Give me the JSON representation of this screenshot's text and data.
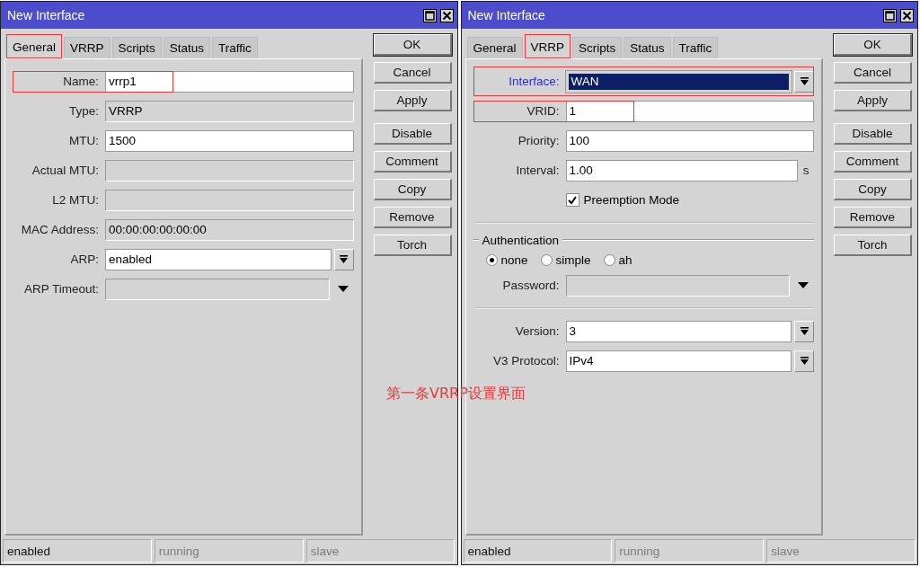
{
  "windows": [
    {
      "title": "New Interface",
      "tabs": [
        {
          "label": "General",
          "selected": true,
          "highlighted": true
        },
        {
          "label": "VRRP",
          "selected": false,
          "highlighted": false
        },
        {
          "label": "Scripts",
          "selected": false,
          "highlighted": false
        },
        {
          "label": "Status",
          "selected": false,
          "highlighted": false
        },
        {
          "label": "Traffic",
          "selected": false,
          "highlighted": false
        }
      ],
      "fields": [
        {
          "kind": "text",
          "label": "Name:",
          "value": "vrrp1",
          "highlighted": true
        },
        {
          "kind": "readonly",
          "label": "Type:",
          "value": "VRRP"
        },
        {
          "kind": "text",
          "label": "MTU:",
          "value": "1500"
        },
        {
          "kind": "readonly",
          "label": "Actual MTU:"
        },
        {
          "kind": "readonly",
          "label": "L2 MTU:"
        },
        {
          "kind": "readonly",
          "label": "MAC Address:",
          "value": "00:00:00:00:00:00"
        },
        {
          "kind": "dropdown",
          "label": "ARP:",
          "value": "enabled"
        },
        {
          "kind": "dropdown-disabled",
          "label": "ARP Timeout:"
        }
      ],
      "button_groups": [
        [
          {
            "label": "OK",
            "default": true
          },
          {
            "label": "Cancel",
            "default": false
          },
          {
            "label": "Apply",
            "default": false
          }
        ],
        [
          {
            "label": "Disable",
            "default": false
          },
          {
            "label": "Comment",
            "default": false
          },
          {
            "label": "Copy",
            "default": false
          },
          {
            "label": "Remove",
            "default": false
          },
          {
            "label": "Torch",
            "default": false
          }
        ]
      ],
      "status_bar": [
        {
          "text": "enabled",
          "disabled": false
        },
        {
          "text": "running",
          "disabled": true
        },
        {
          "text": "slave",
          "disabled": true
        }
      ]
    },
    {
      "title": "New Interface",
      "tabs": [
        {
          "label": "General",
          "selected": false,
          "highlighted": false
        },
        {
          "label": "VRRP",
          "selected": true,
          "highlighted": true
        },
        {
          "label": "Scripts",
          "selected": false,
          "highlighted": false
        },
        {
          "label": "Status",
          "selected": false,
          "highlighted": false
        },
        {
          "label": "Traffic",
          "selected": false,
          "highlighted": false
        }
      ],
      "fields": [
        {
          "kind": "dropdown",
          "label": "Interface:",
          "value": "WAN",
          "focused": true,
          "highlighted": true
        },
        {
          "kind": "text",
          "label": "VRID:",
          "value": "1",
          "highlighted": true
        },
        {
          "kind": "text",
          "label": "Priority:",
          "value": "100"
        },
        {
          "kind": "text",
          "label": "Interval:",
          "value": "1.00",
          "unit": "s"
        },
        {
          "kind": "checkbox",
          "label": "Preemption Mode",
          "checked": true
        },
        {
          "kind": "separator"
        },
        {
          "kind": "section",
          "label": "Authentication"
        },
        {
          "kind": "radio",
          "options": [
            {
              "label": "none",
              "selected": true
            },
            {
              "label": "simple",
              "selected": false
            },
            {
              "label": "ah",
              "selected": false
            }
          ]
        },
        {
          "kind": "dropdown-disabled",
          "label": "Password:"
        },
        {
          "kind": "separator"
        },
        {
          "kind": "dropdown",
          "label": "Version:",
          "value": "3"
        },
        {
          "kind": "dropdown",
          "label": "V3 Protocol:",
          "value": "IPv4"
        }
      ],
      "button_groups": [
        [
          {
            "label": "OK",
            "default": true
          },
          {
            "label": "Cancel",
            "default": false
          },
          {
            "label": "Apply",
            "default": false
          }
        ],
        [
          {
            "label": "Disable",
            "default": false
          },
          {
            "label": "Comment",
            "default": false
          },
          {
            "label": "Copy",
            "default": false
          },
          {
            "label": "Remove",
            "default": false
          },
          {
            "label": "Torch",
            "default": false
          }
        ]
      ],
      "status_bar": [
        {
          "text": "enabled",
          "disabled": false
        },
        {
          "text": "running",
          "disabled": true
        },
        {
          "text": "slave",
          "disabled": true
        }
      ]
    }
  ],
  "caption": "第一条VRRP设置界面"
}
